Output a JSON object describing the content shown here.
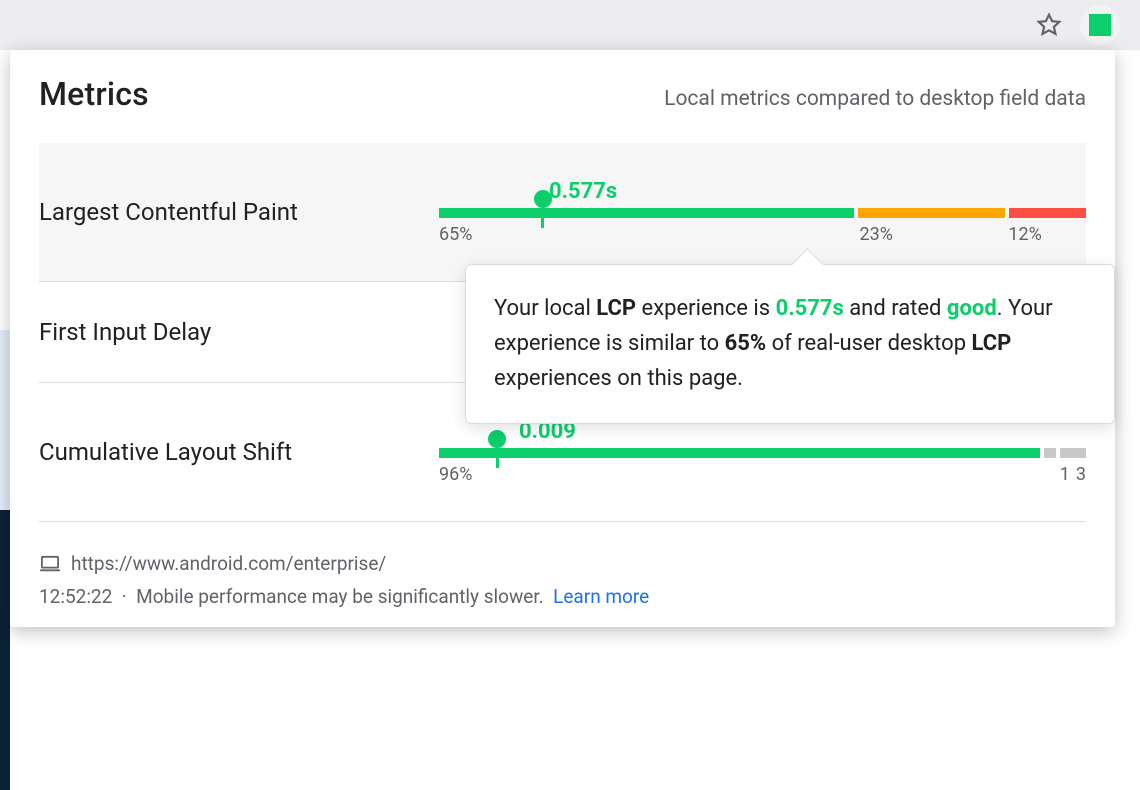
{
  "header": {
    "title": "Metrics",
    "subtitle": "Local metrics compared to desktop field data"
  },
  "metrics": {
    "lcp": {
      "name": "Largest Contentful Paint",
      "value": "0.577s",
      "marker_pct": 16,
      "dist": {
        "good": 65,
        "avg": 23,
        "bad": 12
      },
      "labels": {
        "good": "65%",
        "avg": "23%",
        "bad": "12%"
      }
    },
    "fid": {
      "name": "First Input Delay"
    },
    "cls": {
      "name": "Cumulative Layout Shift",
      "value": "0.009",
      "marker_pct": 9,
      "dist": {
        "good": 96,
        "na1": 1,
        "na2": 3
      },
      "labels": {
        "good": "96%",
        "na1": "1",
        "na2": "3"
      }
    }
  },
  "tooltip": {
    "t1": "Your local ",
    "m1": "LCP",
    "t2": " experience is ",
    "val": "0.577s",
    "t3": " and rated ",
    "rating": "good",
    "t4": ". Your experience is similar to ",
    "pct": "65%",
    "t5": " of real-user desktop ",
    "m2": "LCP",
    "t6": " experiences on this page."
  },
  "footer": {
    "url": "https://www.android.com/enterprise/",
    "time": "12:52:22",
    "sep": "·",
    "note": "Mobile performance may be significantly slower.",
    "link": "Learn more"
  },
  "colors": {
    "good": "#0cce6b",
    "avg": "#ffa500",
    "bad": "#ff4e42",
    "link": "#1a73e8"
  }
}
